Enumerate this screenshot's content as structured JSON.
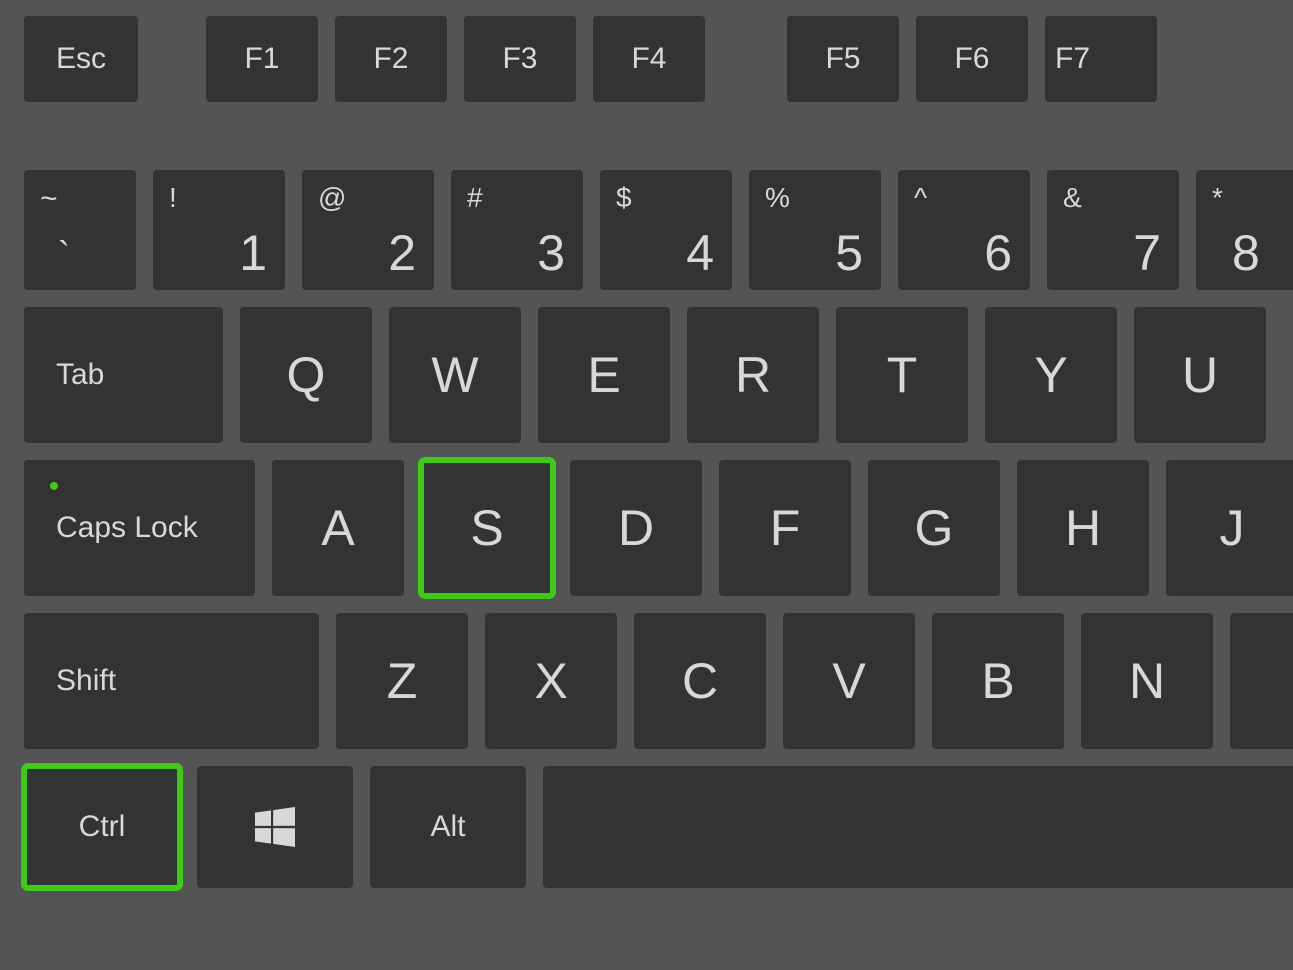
{
  "row0": {
    "esc": "Esc",
    "f1": "F1",
    "f2": "F2",
    "f3": "F3",
    "f4": "F4",
    "f5": "F5",
    "f6": "F6",
    "f7": "F7"
  },
  "row1": {
    "tilde_sym": "~",
    "tilde_key": "`",
    "k1_sym": "!",
    "k1": "1",
    "k2_sym": "@",
    "k2": "2",
    "k3_sym": "#",
    "k3": "3",
    "k4_sym": "$",
    "k4": "4",
    "k5_sym": "%",
    "k5": "5",
    "k6_sym": "^",
    "k6": "6",
    "k7_sym": "&",
    "k7": "7",
    "k8_sym": "*",
    "k8": "8"
  },
  "row2": {
    "tab": "Tab",
    "q": "Q",
    "w": "W",
    "e": "E",
    "r": "R",
    "t": "T",
    "y": "Y",
    "u": "U"
  },
  "row3": {
    "caps": "Caps Lock",
    "a": "A",
    "s": "S",
    "d": "D",
    "f": "F",
    "g": "G",
    "h": "H",
    "j": "J"
  },
  "row4": {
    "shift": "Shift",
    "z": "Z",
    "x": "X",
    "c": "C",
    "v": "V",
    "b": "B",
    "n": "N"
  },
  "row5": {
    "ctrl": "Ctrl",
    "alt": "Alt"
  },
  "highlighted_keys": [
    "ctrl",
    "s"
  ],
  "colors": {
    "highlight": "#3fca1a"
  }
}
